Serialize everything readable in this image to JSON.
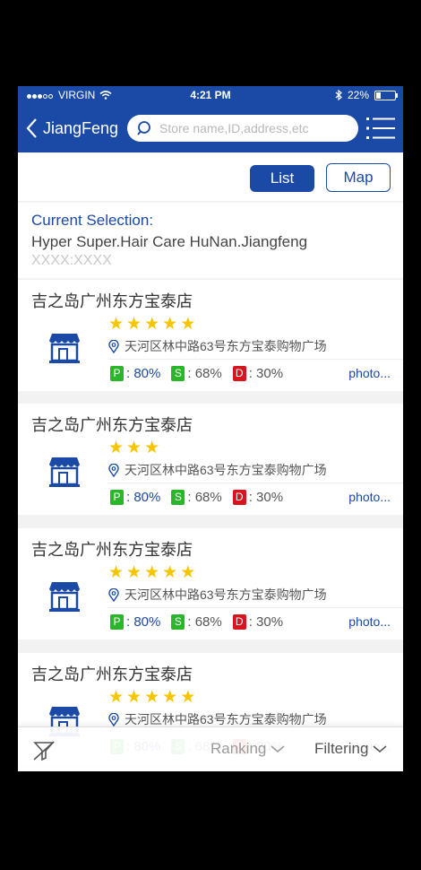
{
  "status": {
    "carrier": "VIRGIN",
    "time": "4:21 PM",
    "battery": "22%"
  },
  "nav": {
    "back_label": "JiangFeng",
    "search_placeholder": "Store name,ID,address,etc"
  },
  "view_toggle": {
    "list": "List",
    "map": "Map",
    "selected": "List"
  },
  "selection": {
    "label": "Current Selection:",
    "name": "Hyper Super.Hair Care HuNan.Jiangfeng",
    "code": "XXXX:XXXX"
  },
  "stores": [
    {
      "name": "吉之岛广州东方宝泰店",
      "stars": 5,
      "address": "天河区林中路63号东方宝泰购物广场",
      "p_label": "P",
      "p_value": ": 80%",
      "s_label": "S",
      "s_value": ": 68%",
      "d_label": "D",
      "d_value": ": 30%",
      "photo": "photo..."
    },
    {
      "name": "吉之岛广州东方宝泰店",
      "stars": 3,
      "address": "天河区林中路63号东方宝泰购物广场",
      "p_label": "P",
      "p_value": ": 80%",
      "s_label": "S",
      "s_value": ": 68%",
      "d_label": "D",
      "d_value": ": 30%",
      "photo": "photo..."
    },
    {
      "name": "吉之岛广州东方宝泰店",
      "stars": 5,
      "address": "天河区林中路63号东方宝泰购物广场",
      "p_label": "P",
      "p_value": ": 80%",
      "s_label": "S",
      "s_value": ": 68%",
      "d_label": "D",
      "d_value": ": 30%",
      "photo": "photo..."
    },
    {
      "name": "吉之岛广州东方宝泰店",
      "stars": 5,
      "address": "天河区林中路63号东方宝泰购物广场",
      "p_label": "P",
      "p_value": ": 80%",
      "s_label": "S",
      "s_value": ": 68%",
      "d_label": "D",
      "d_value": ": 30%",
      "photo": "photo..."
    }
  ],
  "bottom": {
    "ranking": "Ranking",
    "filtering": "Filtering"
  },
  "colors": {
    "primary": "#1b4aa6",
    "star": "#f7c400",
    "p": "#2bb52b",
    "s": "#2bb52b",
    "d": "#d8141e"
  },
  "icons": [
    "back-chevron-icon",
    "search-icon",
    "menu-list-icon",
    "shop-icon",
    "location-pin-icon",
    "star-icon",
    "clear-filter-icon",
    "chevron-down-icon"
  ]
}
